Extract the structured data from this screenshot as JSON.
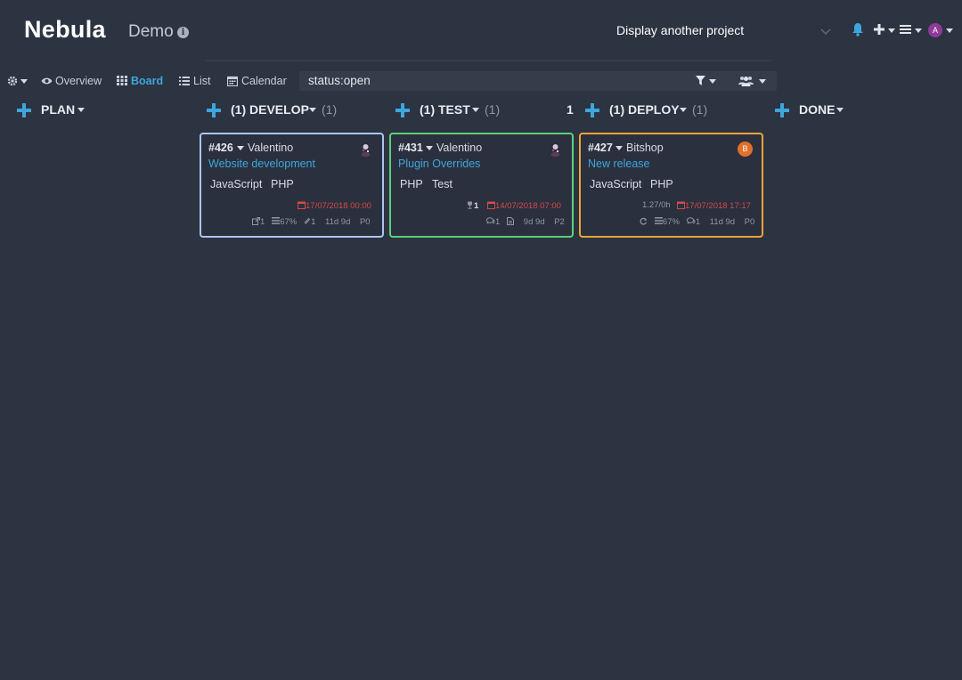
{
  "header": {
    "brand": "Nebula",
    "project_name": "Demo",
    "project_select_label": "Display another project",
    "avatar_letter": "A"
  },
  "toolbar": {
    "overview": "Overview",
    "board": "Board",
    "list": "List",
    "calendar": "Calendar",
    "filter_query": "status:open"
  },
  "columns": [
    {
      "title": "PLAN",
      "count": ""
    },
    {
      "title": "(1) DEVELOP",
      "count": "(1)"
    },
    {
      "title": "(1) TEST",
      "count": "(1)"
    },
    {
      "title": "(1) DEPLOY",
      "count": "(1)",
      "wip_limit": "1"
    },
    {
      "title": "DONE",
      "count": ""
    }
  ],
  "cards": [
    {
      "id": "#426",
      "owner": "Valentino",
      "title": "Website development",
      "tags": [
        "JavaScript",
        "PHP"
      ],
      "date": "17/07/2018 00:00",
      "links": "1",
      "checklist": "67%",
      "attachments": "1",
      "estimate": "11d 9d",
      "priority": "P0",
      "border_color": "#a9c6f2"
    },
    {
      "id": "#431",
      "owner": "Valentino",
      "title": "Plugin Overrides",
      "tags": [
        "PHP",
        "Test"
      ],
      "trophy": "1",
      "date": "14/07/2018 07:00",
      "comments": "1",
      "estimate": "9d 9d",
      "priority": "P2",
      "border_color": "#5ad07a"
    },
    {
      "id": "#427",
      "owner": "Bitshop",
      "owner_avatar_letter": "B",
      "title": "New release",
      "tags": [
        "JavaScript",
        "PHP"
      ],
      "time_spent": "1.27/0h",
      "date": "17/07/2018 17:17",
      "checklist": "67%",
      "comments": "1",
      "estimate": "11d 9d",
      "priority": "P0",
      "border_color": "#f1a437"
    }
  ],
  "colors": {
    "background": "#2c3341",
    "accent": "#3ea6dd",
    "due_date": "#d54a4a"
  }
}
